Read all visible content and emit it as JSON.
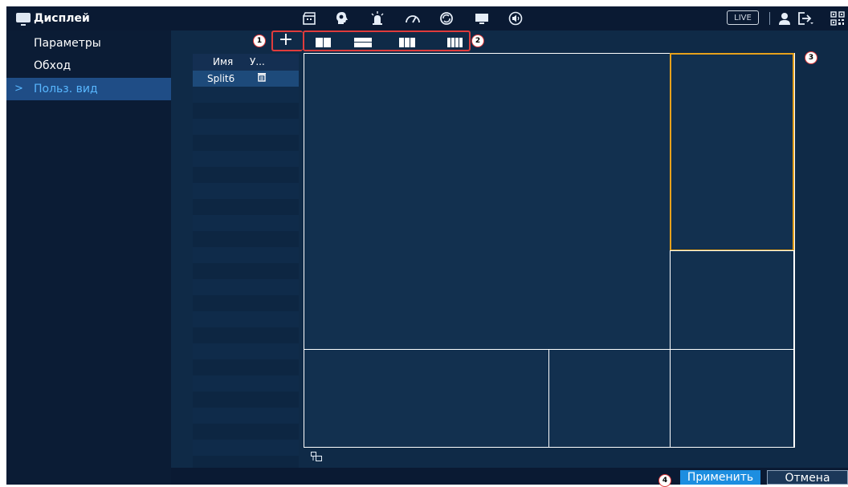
{
  "topbar": {
    "title": "Дисплей",
    "live_label": "LIVE",
    "icons": [
      "clapperboard-icon",
      "ai-head-icon",
      "alarm-light-icon",
      "speedometer-icon",
      "sync-icon",
      "monitor-icon",
      "speaker-icon",
      "user-icon",
      "logout-icon",
      "qr-code-icon"
    ]
  },
  "sidebar": {
    "items": [
      {
        "label": "Параметры",
        "active": false
      },
      {
        "label": "Обход",
        "active": false
      },
      {
        "label": "Польз. вид",
        "active": true
      }
    ]
  },
  "main": {
    "list": {
      "headers": [
        "Имя",
        "У..."
      ],
      "rows": [
        {
          "name": "Split6",
          "action_icon": "trash-icon"
        }
      ]
    },
    "annotations": [
      "1",
      "2",
      "3",
      "4"
    ]
  },
  "footer": {
    "apply_label": "Применить",
    "cancel_label": "Отмена"
  },
  "colors": {
    "accent": "#1d8ee0",
    "selected_cell": "#e6a11c",
    "annotation": "#e03c3c",
    "sidebar_active": "#1f4d86",
    "sidebar_active_text": "#58b7ff"
  }
}
